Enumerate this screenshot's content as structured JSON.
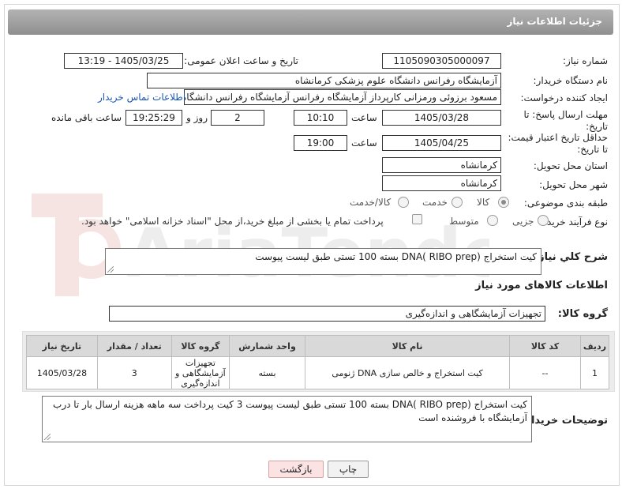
{
  "header": {
    "title": "جزئیات اطلاعات نیاز"
  },
  "fields": {
    "need_number_label": "شماره نیاز:",
    "need_number": "1105090305000097",
    "announce_label": "تاریخ و ساعت اعلان عمومی:",
    "announce_value": "1405/03/25 - 13:19",
    "buyer_label": "نام دستگاه خریدار:",
    "buyer_value": "آزمایشگاه رفرانس دانشگاه علوم پزشکی کرمانشاه",
    "creator_label": "ایجاد کننده درخواست:",
    "creator_value": "مسعود برزوئی ورمزانی کارپرداز آزمایشگاه رفرانس آزمایشگاه رفرانس دانشگاه ع",
    "contact_link": "اطلاعات تماس خریدار",
    "deadline_label": "مهلت ارسال پاسخ: تا تاریخ:",
    "deadline_date": "1405/03/28",
    "time_label": "ساعت",
    "deadline_time": "10:10",
    "days_value": "2",
    "days_label": "روز و",
    "remaining_value": "19:25:29",
    "remaining_label": "ساعت باقی مانده",
    "price_valid_label": "حداقل تاریخ اعتبار قیمت: تا تاریخ:",
    "price_valid_date": "1405/04/25",
    "price_valid_time": "19:00",
    "province_label": "استان محل تحویل:",
    "province_value": "کرمانشاه",
    "city_label": "شهر محل تحویل:",
    "city_value": "کرمانشاه",
    "category_label": "طبقه بندی موضوعی:",
    "category_options": [
      "کالا",
      "خدمت",
      "کالا/خدمت"
    ],
    "process_label": "نوع فرآیند خرید :",
    "process_options": [
      "جزیی",
      "متوسط"
    ],
    "payment_note": "پرداخت تمام یا بخشی از مبلغ خرید،از محل \"اسناد خزانه اسلامی\" خواهد بود."
  },
  "description": {
    "label": "شرح کلي نياز:",
    "value": "کیت استخراج (DNA( RIBO prep بسته 100 تستی طبق لیست پیوست"
  },
  "goods": {
    "section_title": "اطلاعات کالاهای مورد نیاز",
    "group_label": "گروه کالا:",
    "group_value": "تجهیزات آزمایشگاهی و اندازه‌گیری",
    "columns": [
      "ردیف",
      "کد کالا",
      "نام کالا",
      "واحد شمارش",
      "گروه کالا",
      "تعداد / مقدار",
      "تاریخ نیاز"
    ],
    "rows": [
      {
        "index": "1",
        "code": "--",
        "name": "کیت استخراج و خالص سازی DNA ژنومی",
        "unit": "بسته",
        "group": "تجهیزات آزمایشگاهی و اندازه‌گیری",
        "qty": "3",
        "date": "1405/03/28"
      }
    ]
  },
  "buyer_notes": {
    "label": "توضیحات خریدار:",
    "value": "کیت استخراج (DNA( RIBO prep بسته 100 تستی طبق لیست پیوست 3 کیت پرداخت سه ماهه هزینه ارسال بار تا درب آزمایشگاه با فروشنده است"
  },
  "buttons": {
    "print": "چاپ",
    "back": "بازگشت"
  },
  "watermark": {
    "text": "AriaTender.net"
  }
}
